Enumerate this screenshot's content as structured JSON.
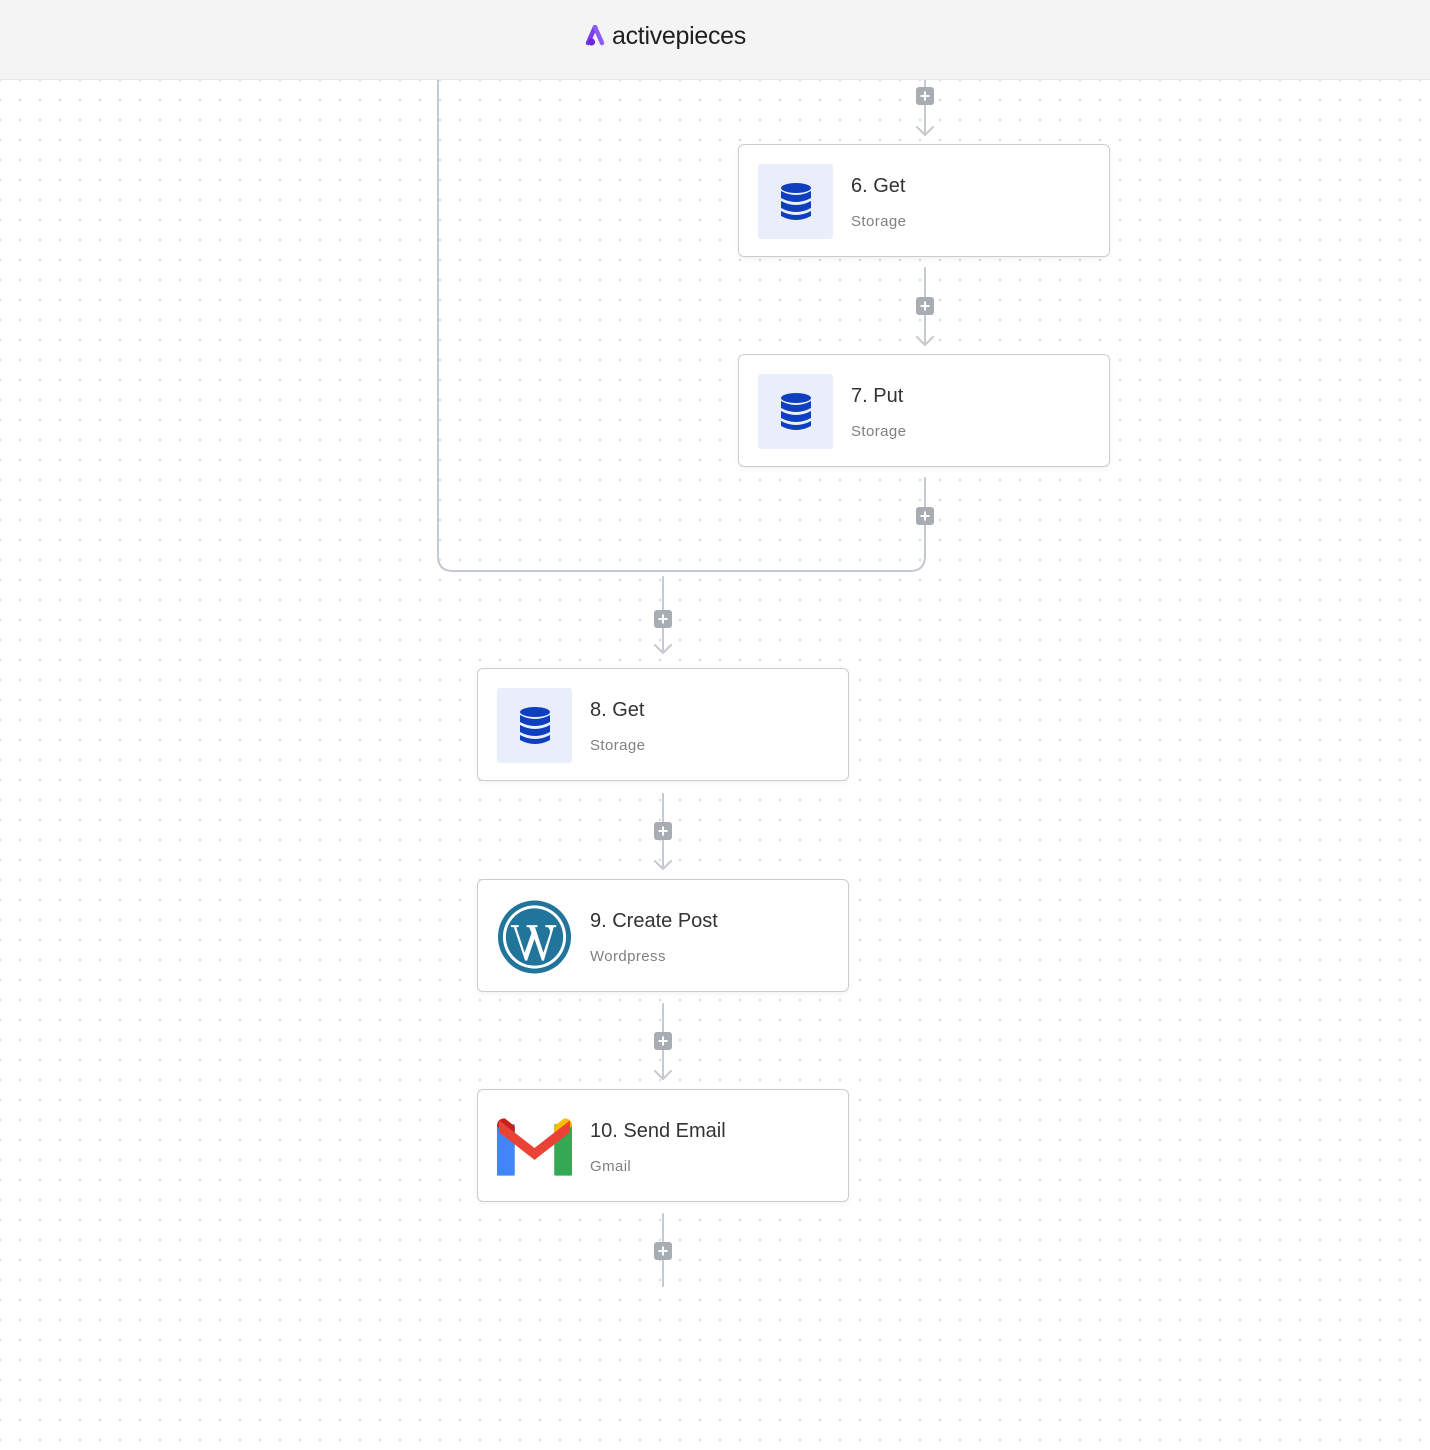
{
  "header": {
    "brand": "activepieces",
    "brand_color": "#7c3aed"
  },
  "flow": {
    "line_color": "#c5c9d0",
    "plus_color": "#a8acb3",
    "steps": [
      {
        "title": "6. Get",
        "subtitle": "Storage",
        "icon": "database-icon"
      },
      {
        "title": "7. Put",
        "subtitle": "Storage",
        "icon": "database-icon"
      },
      {
        "title": "8. Get",
        "subtitle": "Storage",
        "icon": "database-icon"
      },
      {
        "title": "9. Create Post",
        "subtitle": "Wordpress",
        "icon": "wordpress-icon"
      },
      {
        "title": "10. Send Email",
        "subtitle": "Gmail",
        "icon": "gmail-icon"
      }
    ]
  }
}
